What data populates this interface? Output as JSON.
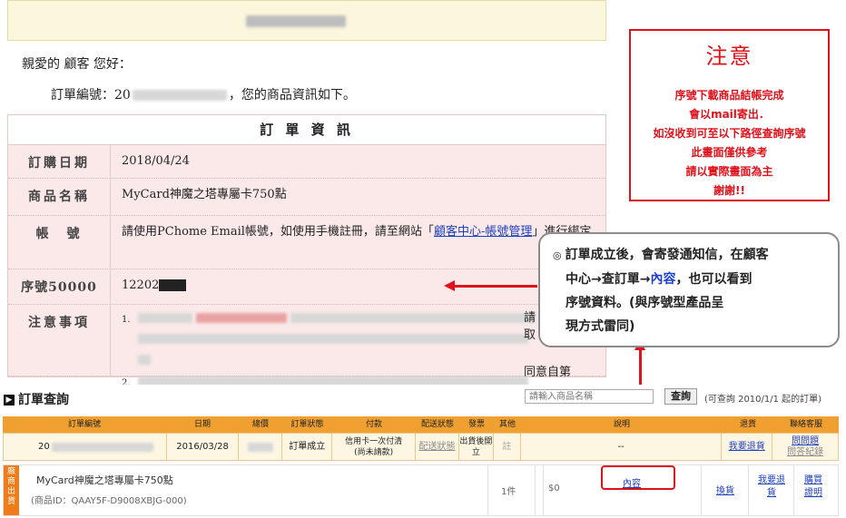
{
  "email": {
    "greeting": "親愛的 顧客 您好：",
    "order_no_prefix": "訂單編號：20",
    "order_no_suffix": "，您的商品資訊如下。",
    "info_title": "訂 單 資 訊",
    "rows": {
      "date_label": "訂購日期",
      "date_value": "2018/04/24",
      "product_label": "商品名稱",
      "product_value": "MyCard神魔之塔專屬卡750點",
      "account_label": "帳　號",
      "account_text": "請使用PChome Email帳號，如使用手機註冊，請至網站「",
      "account_link": "顧客中心-帳號管理",
      "account_tail": "」進行綁定",
      "serial_label": "序號50000",
      "serial_value": "12202",
      "notes_label": "注意事項",
      "note1_num": "1.",
      "note1_tail_a": "請",
      "note1_tail_b": "取",
      "note2_num": "2.",
      "note2_tail": "同意自第"
    }
  },
  "notice": {
    "title": "注意",
    "lines": [
      "序號下載商品結帳完成",
      "會以mail寄出．",
      "如沒收到可至以下路徑查詢序號",
      "此畫面僅供參考",
      "請以實際畫面為主",
      "謝謝!!"
    ],
    "color": "#e0111a"
  },
  "callout": {
    "bullet": "◎",
    "line1": "訂單成立後，會寄發通知信，在顧客",
    "line2_a": "中心→查訂單→",
    "line2_hl": "內容",
    "line2_b": "，也可以看到",
    "line3": "序號資料。(與序號型產品呈",
    "line4": "現方式雷同)"
  },
  "query": {
    "title": "訂單查詢",
    "search_placeholder": "請輸入商品名稱",
    "search_button": "查詢",
    "range_note": "(可查詢 2010/1/1 起的訂單)",
    "headers": [
      "訂單編號",
      "日期",
      "總價",
      "訂單狀態",
      "付款",
      "配送狀態",
      "發票",
      "其他",
      "說明",
      "退貨",
      "聯絡客服"
    ],
    "order": {
      "order_no_prefix": "20",
      "date": "2016/03/28",
      "status": "訂單成立",
      "payment": "信用卡一次付清\n(尚未請款)",
      "shipping": "配送狀態",
      "invoice": "出貨後開立",
      "other": "註",
      "note": "--",
      "return": "我要退貨",
      "contact_1": "問問題",
      "contact_2": "問答紀錄"
    },
    "item": {
      "vendor_tag": "廠商出貨",
      "name": "MyCard神魔之塔專屬卡750點",
      "id": "(商品ID：QAAY5F-D9008XBJG-000)",
      "qty": "1件",
      "price": "$0",
      "detail": "內容",
      "exchange": "換貨",
      "return": "我要退貨",
      "buy": "購買證明"
    }
  }
}
